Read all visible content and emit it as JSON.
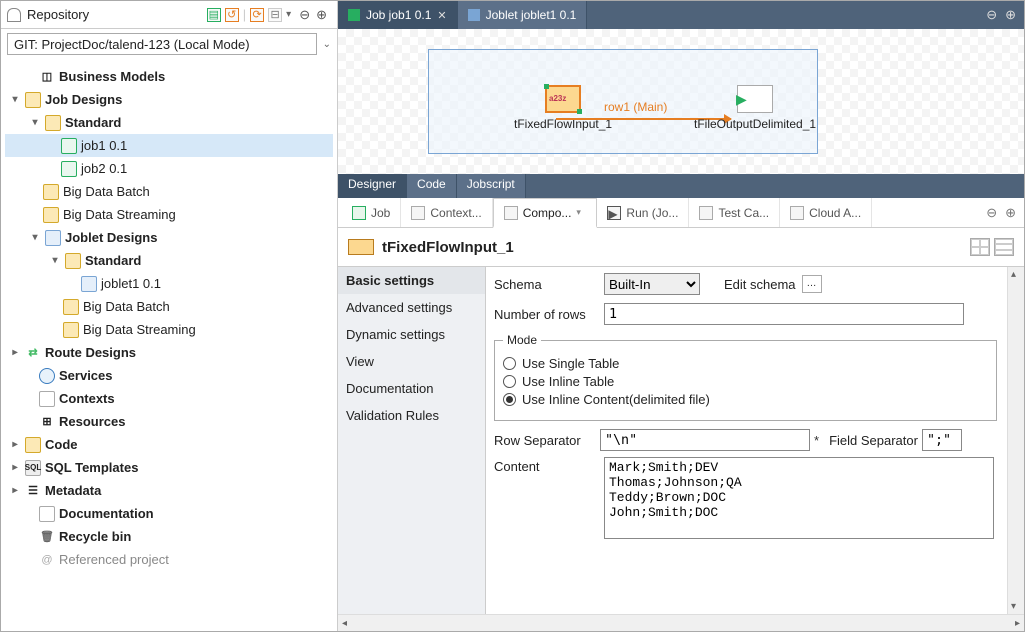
{
  "repo": {
    "title": "Repository",
    "selector": "GIT: ProjectDoc/talend-123   (Local Mode)"
  },
  "tree": {
    "business_models": "Business Models",
    "job_designs": "Job Designs",
    "standard": "Standard",
    "job1": "job1 0.1",
    "job2": "job2 0.1",
    "big_data_batch": "Big Data Batch",
    "big_data_streaming": "Big Data Streaming",
    "joblet_designs": "Joblet Designs",
    "joblet1": "joblet1 0.1",
    "route_designs": "Route Designs",
    "services": "Services",
    "contexts": "Contexts",
    "resources": "Resources",
    "code": "Code",
    "sql_templates": "SQL Templates",
    "metadata": "Metadata",
    "documentation": "Documentation",
    "recycle_bin": "Recycle bin",
    "referenced_project": "Referenced project"
  },
  "editor_tabs": {
    "job": "Job job1 0.1",
    "joblet": "Joblet joblet1 0.1"
  },
  "canvas": {
    "comp1": "tFixedFlowInput_1",
    "comp2": "tFileOutputDelimited_1",
    "flow_label": "row1 (Main)"
  },
  "designer_tabs": {
    "designer": "Designer",
    "code": "Code",
    "jobscript": "Jobscript"
  },
  "bottom_tabs": {
    "job": "Job",
    "context": "Context...",
    "component": "Compo...",
    "run": "Run (Jo...",
    "test": "Test Ca...",
    "cloud": "Cloud A..."
  },
  "component": {
    "name": "tFixedFlowInput_1",
    "sidebar": {
      "basic": "Basic settings",
      "advanced": "Advanced settings",
      "dynamic": "Dynamic settings",
      "view": "View",
      "documentation": "Documentation",
      "validation": "Validation Rules"
    },
    "schema_label": "Schema",
    "schema_value": "Built-In",
    "edit_schema": "Edit schema",
    "num_rows_label": "Number of rows",
    "num_rows_value": "1",
    "mode_legend": "Mode",
    "mode_single": "Use Single Table",
    "mode_inline_table": "Use Inline Table",
    "mode_inline_content": "Use Inline Content(delimited file)",
    "row_sep_label": "Row Separator",
    "row_sep_value": "\"\\n\"",
    "field_sep_label": "Field Separator",
    "field_sep_value": "\";\"",
    "content_label": "Content",
    "content_value": "Mark;Smith;DEV\nThomas;Johnson;QA\nTeddy;Brown;DOC\nJohn;Smith;DOC"
  }
}
